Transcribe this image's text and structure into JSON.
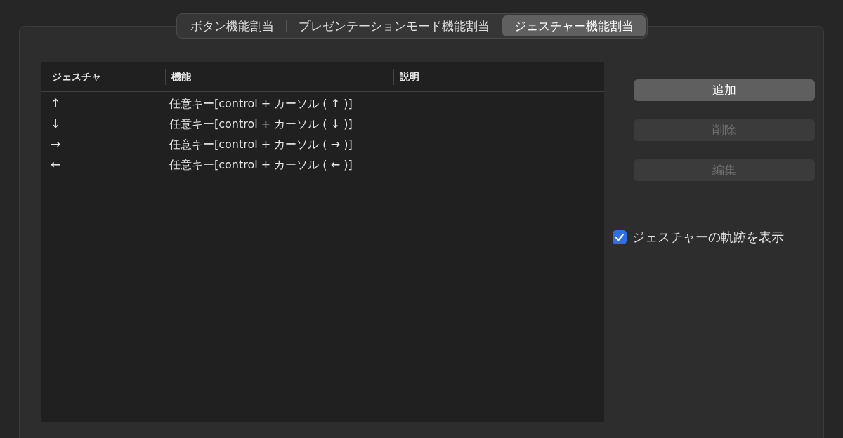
{
  "tabs": [
    {
      "label": "ボタン機能割当",
      "selected": false
    },
    {
      "label": "プレゼンテーションモード機能割当",
      "selected": false
    },
    {
      "label": "ジェスチャー機能割当",
      "selected": true
    }
  ],
  "table": {
    "columns": [
      "ジェスチャ",
      "機能",
      "説明"
    ],
    "rows": [
      {
        "gesture": "↑",
        "function": "任意キー[control + カーソル ( ↑ )]"
      },
      {
        "gesture": "↓",
        "function": "任意キー[control + カーソル ( ↓ )]"
      },
      {
        "gesture": "→",
        "function": "任意キー[control + カーソル ( → )]"
      },
      {
        "gesture": "←",
        "function": "任意キー[control + カーソル ( ← )]"
      }
    ]
  },
  "buttons": [
    {
      "label": "追加",
      "disabled": false
    },
    {
      "label": "削除",
      "disabled": true
    },
    {
      "label": "編集",
      "disabled": true
    }
  ],
  "checkbox": {
    "label": "ジェスチャーの軌跡を表示",
    "checked": true
  }
}
